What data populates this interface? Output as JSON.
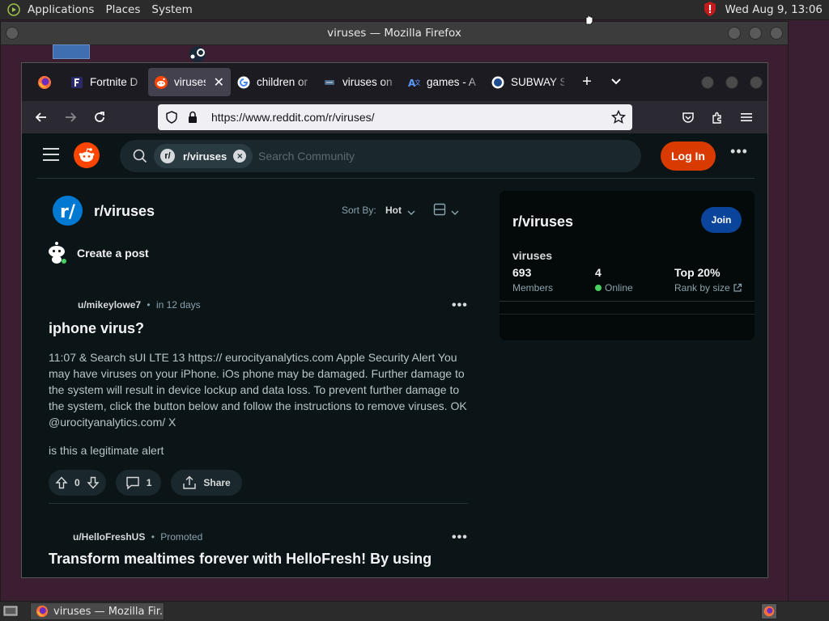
{
  "top_panel": {
    "applications": "Applications",
    "places": "Places",
    "system": "System",
    "clock": "Wed Aug  9, 13:06"
  },
  "outer_window": {
    "title": "viruses — Mozilla Firefox"
  },
  "firefox": {
    "tabs": [
      {
        "label": "Fortnite D",
        "icon": "fortnite-icon"
      },
      {
        "label": "viruses",
        "icon": "reddit-icon",
        "active": true
      },
      {
        "label": "children or",
        "icon": "google-icon"
      },
      {
        "label": "viruses on",
        "icon": "site-icon"
      },
      {
        "label": "games - A",
        "icon": "translate-icon"
      },
      {
        "label": "SUBWAY S",
        "icon": "subway-icon"
      }
    ],
    "url": "https://www.reddit.com/r/viruses/"
  },
  "reddit": {
    "header": {
      "chip_prefix": "r/",
      "chip_label": "r/viruses",
      "search_placeholder": "Search Community",
      "login": "Log In"
    },
    "subreddit": {
      "icon_text": "r/",
      "name": "r/viruses",
      "sort_label": "Sort By:",
      "sort_value": "Hot"
    },
    "create_post": "Create a post",
    "posts": [
      {
        "author": "u/mikeylowe7",
        "time": "in 12 days",
        "title": "iphone virus?",
        "body": "11:07 & Search sUI LTE 13 https:// eurocityanalytics.com Apple Security Alert You may have viruses on your iPhone. iOs phone may be damaged. Further damage to the system will result in device lockup and data loss. To prevent further damage to the system, click the button below and follow the instructions to remove viruses. OK @urocityanalytics.com/ X",
        "body2": "is this a legitimate alert",
        "votes": "0",
        "comments": "1",
        "share": "Share"
      },
      {
        "author": "u/HelloFreshUS",
        "time": "Promoted",
        "title": "Transform mealtimes forever with HelloFresh! By using"
      }
    ],
    "sidebar": {
      "title": "r/viruses",
      "join": "Join",
      "subtitle": "viruses",
      "members_value": "693",
      "members_label": "Members",
      "online_value": "4",
      "online_label": "Online",
      "rank_value": "Top 20%",
      "rank_label": "Rank by size"
    }
  },
  "taskbar": {
    "task_label": "viruses — Mozilla Fir..."
  },
  "colors": {
    "reddit_orange": "#ff4500",
    "login_button": "#d93a00",
    "join_button": "#0a449b",
    "page_bg": "#0b1416",
    "online_dot": "#46d160"
  }
}
